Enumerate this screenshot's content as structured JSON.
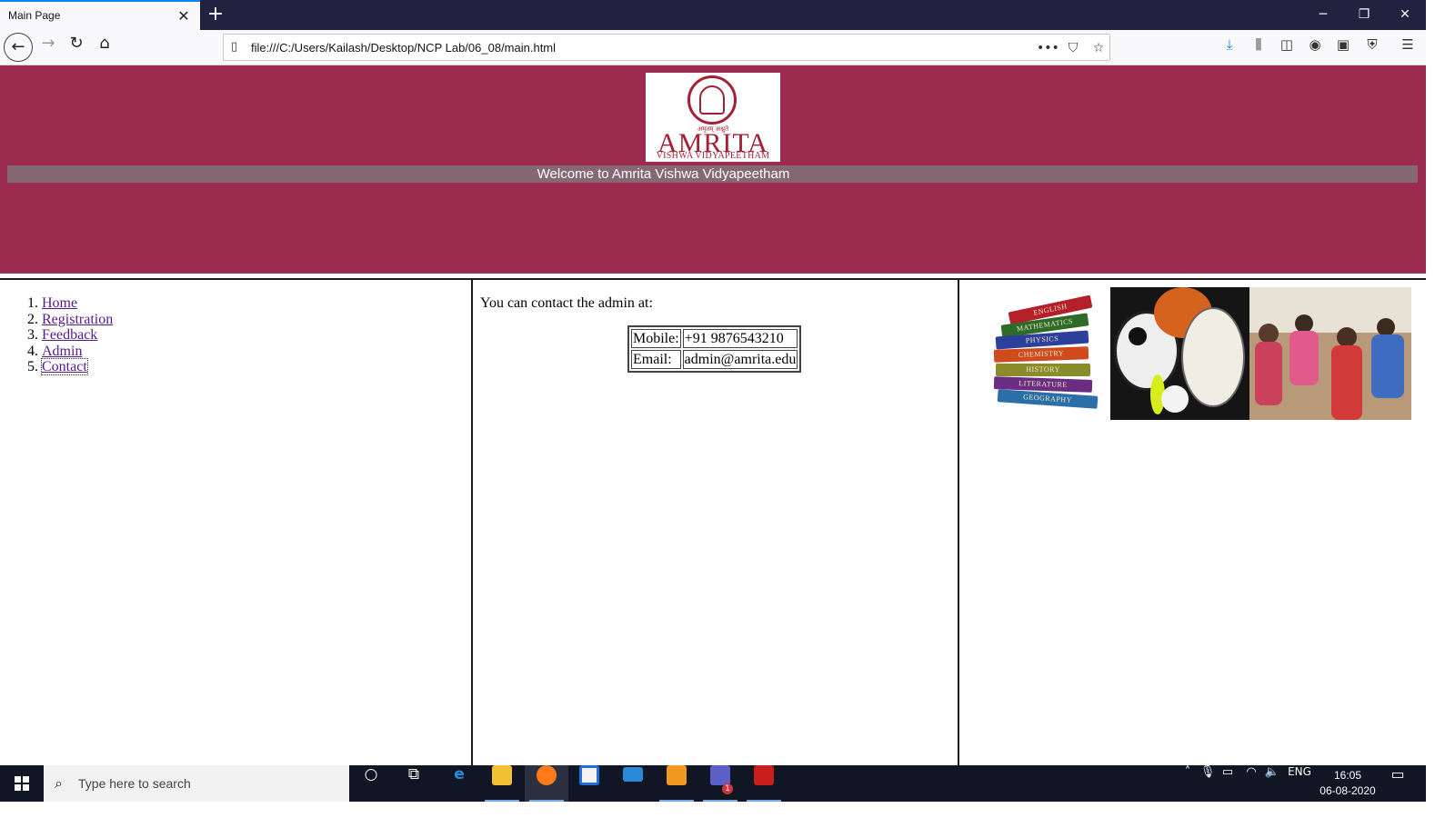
{
  "browser": {
    "tab_title": "Main Page",
    "url": "file:///C:/Users/Kailash/Desktop/NCP Lab/06_08/main.html"
  },
  "header": {
    "logo_script": "अमृतम् अश्नुते",
    "logo_name": "AMRITA",
    "logo_subtitle": "VISHWA VIDYAPEETHAM",
    "welcome_text": "Welcome to Amrita Vishwa Vidyapeetham"
  },
  "menu": {
    "items": [
      {
        "number": "1.",
        "label": "Home"
      },
      {
        "number": "2.",
        "label": "Registration"
      },
      {
        "number": "3.",
        "label": "Feedback"
      },
      {
        "number": "4.",
        "label": "Admin"
      },
      {
        "number": "5.",
        "label": "Contact"
      }
    ]
  },
  "contact": {
    "intro": "You can contact the admin at:",
    "rows": [
      {
        "label": "Mobile:",
        "value": "+91 9876543210"
      },
      {
        "label": "Email:",
        "value": "admin@amrita.edu"
      }
    ]
  },
  "images": {
    "books": [
      "ENGLISH",
      "MATHEMATICS",
      "PHYSICS",
      "CHEMISTRY",
      "HISTORY",
      "LITERATURE",
      "GEOGRAPHY"
    ]
  },
  "taskbar": {
    "search_placeholder": "Type here to search",
    "language": "ENG",
    "time": "16:05",
    "date": "06-08-2020",
    "teams_badge": "1"
  },
  "colors": {
    "header_bg": "#9b2c50",
    "welcome_bar": "#866875",
    "link": "#551a8b"
  }
}
